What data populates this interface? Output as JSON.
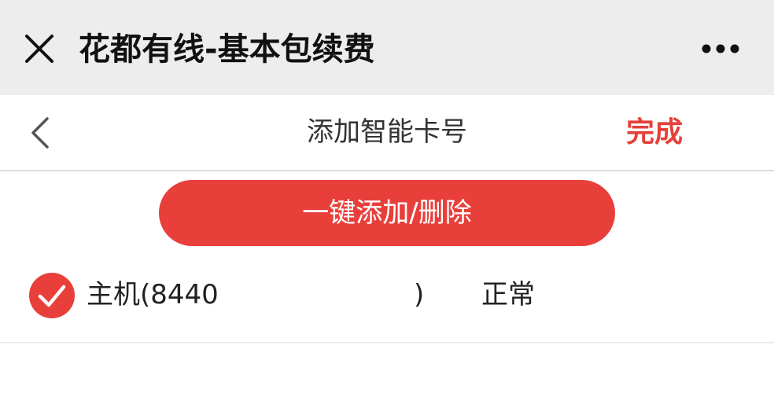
{
  "topbar": {
    "title": "花都有线-基本包续费",
    "close_icon": "close-icon",
    "more_icon": "more-icon"
  },
  "navbar": {
    "title": "添加智能卡号",
    "done_label": "完成",
    "back_icon": "chevron-left-icon"
  },
  "action": {
    "label": "一键添加/删除"
  },
  "cards": [
    {
      "name": "主机(8440",
      "paren": ")",
      "status": "正常",
      "checked": true
    }
  ],
  "colors": {
    "accent": "#e93f3b",
    "done_text": "#e5403a",
    "topbar_bg": "#ededed"
  }
}
